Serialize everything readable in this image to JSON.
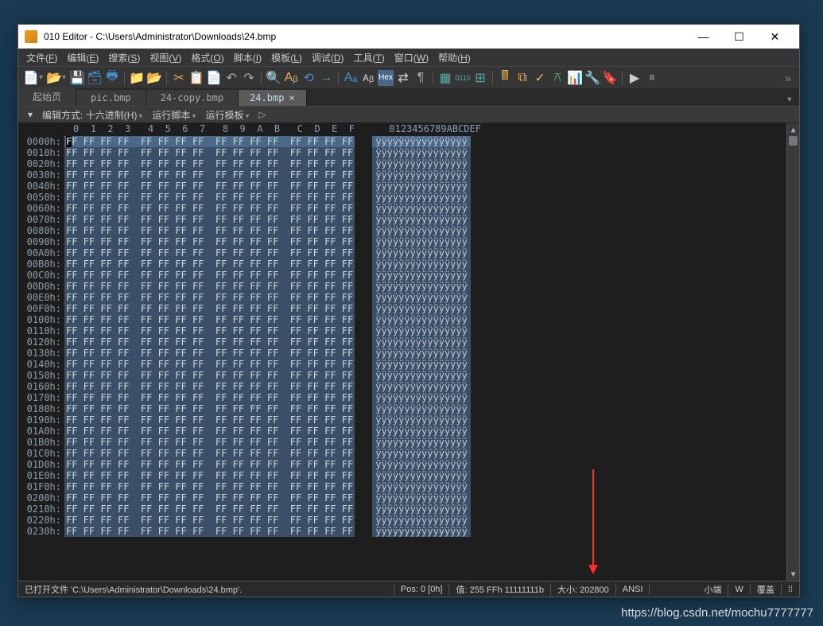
{
  "window": {
    "title": "010 Editor - C:\\Users\\Administrator\\Downloads\\24.bmp",
    "min": "—",
    "max": "☐",
    "close": "✕"
  },
  "menu": {
    "items": [
      {
        "label": "文件(F)",
        "u": "F"
      },
      {
        "label": "编辑(E)",
        "u": "E"
      },
      {
        "label": "搜索(S)",
        "u": "S"
      },
      {
        "label": "视图(V)",
        "u": "V"
      },
      {
        "label": "格式(O)",
        "u": "O"
      },
      {
        "label": "脚本(I)",
        "u": "I"
      },
      {
        "label": "模板(L)",
        "u": "L"
      },
      {
        "label": "调试(D)",
        "u": "D"
      },
      {
        "label": "工具(T)",
        "u": "T"
      },
      {
        "label": "窗口(W)",
        "u": "W"
      },
      {
        "label": "帮助(H)",
        "u": "H"
      }
    ]
  },
  "tabs": [
    {
      "label": "起始页",
      "active": false
    },
    {
      "label": "pic.bmp",
      "active": false
    },
    {
      "label": "24-copy.bmp",
      "active": false
    },
    {
      "label": "24.bmp",
      "active": true
    }
  ],
  "subtoolbar": {
    "edit_mode_label": "编辑方式: 十六进制(H)",
    "run_script": "运行脚本",
    "run_template": "运行模板"
  },
  "hex": {
    "header": "         0  1  2  3   4  5  6  7   8  9  A  B   C  D  E  F      0123456789ABCDEF",
    "offsets": [
      "0000h:",
      "0010h:",
      "0020h:",
      "0030h:",
      "0040h:",
      "0050h:",
      "0060h:",
      "0070h:",
      "0080h:",
      "0090h:",
      "00A0h:",
      "00B0h:",
      "00C0h:",
      "00D0h:",
      "00E0h:",
      "00F0h:",
      "0100h:",
      "0110h:",
      "0120h:",
      "0130h:",
      "0140h:",
      "0150h:",
      "0160h:",
      "0170h:",
      "0180h:",
      "0190h:",
      "01A0h:",
      "01B0h:",
      "01C0h:",
      "01D0h:",
      "01E0h:",
      "01F0h:",
      "0200h:",
      "0210h:",
      "0220h:",
      "0230h:"
    ],
    "bytes": "FF FF FF FF  FF FF FF FF  FF FF FF FF  FF FF FF FF",
    "ascii": "ÿÿÿÿÿÿÿÿÿÿÿÿÿÿÿÿ"
  },
  "status": {
    "opened": "已打开文件 'C:\\Users\\Administrator\\Downloads\\24.bmp'.",
    "pos": "Pos: 0 [0h]",
    "val": "值: 255 FFh 11111111b",
    "size": "大小: 202800",
    "encoding": "ANSI",
    "endian": "小端",
    "mode_w": "W",
    "overwrite": "覆盖",
    "resize": "⁞⁞"
  },
  "watermark": "https://blog.csdn.net/mochu7777777"
}
